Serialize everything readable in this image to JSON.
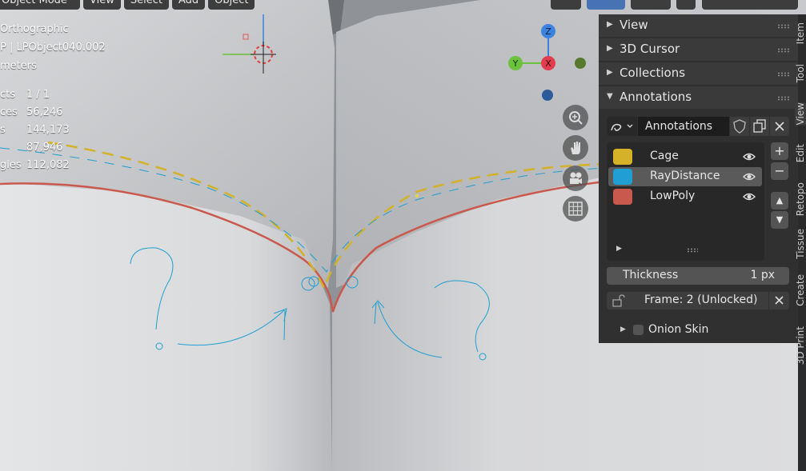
{
  "header": {
    "mode": "Object Mode",
    "menus": [
      "View",
      "Select",
      "Add",
      "Object"
    ]
  },
  "overlay": {
    "projection": "Orthographic",
    "object": "P | LPObject040.002",
    "units": "meters",
    "stats": [
      {
        "label": "cts",
        "value": "1 / 1"
      },
      {
        "label": "ces",
        "value": "56,246"
      },
      {
        "label": "s",
        "value": "144,173"
      },
      {
        "label": "",
        "value": "87,946"
      },
      {
        "label": "gles",
        "value": "112,082"
      }
    ]
  },
  "gizmo": {
    "z": "Z",
    "y": "Y",
    "x": "X"
  },
  "panel": {
    "sections": [
      "View",
      "3D Cursor",
      "Collections",
      "Annotations"
    ],
    "annotation_name": "Annotations",
    "layers": [
      {
        "name": "Cage",
        "color": "#d4b126"
      },
      {
        "name": "RayDistance",
        "color": "#1f9fd3"
      },
      {
        "name": "LowPoly",
        "color": "#c9594d"
      }
    ],
    "thickness_label": "Thickness",
    "thickness_value": "1 px",
    "frame_label": "Frame: 2 (Unlocked)",
    "onion_skin": "Onion Skin"
  },
  "tabs": [
    "Item",
    "Tool",
    "View",
    "Edit",
    "Retopo",
    "Tissue",
    "Create",
    "3D Print"
  ],
  "colors": {
    "cage": "#d4b126",
    "ray": "#1f9fd3",
    "lowpoly": "#c9594d",
    "accent": "#4772b3"
  }
}
